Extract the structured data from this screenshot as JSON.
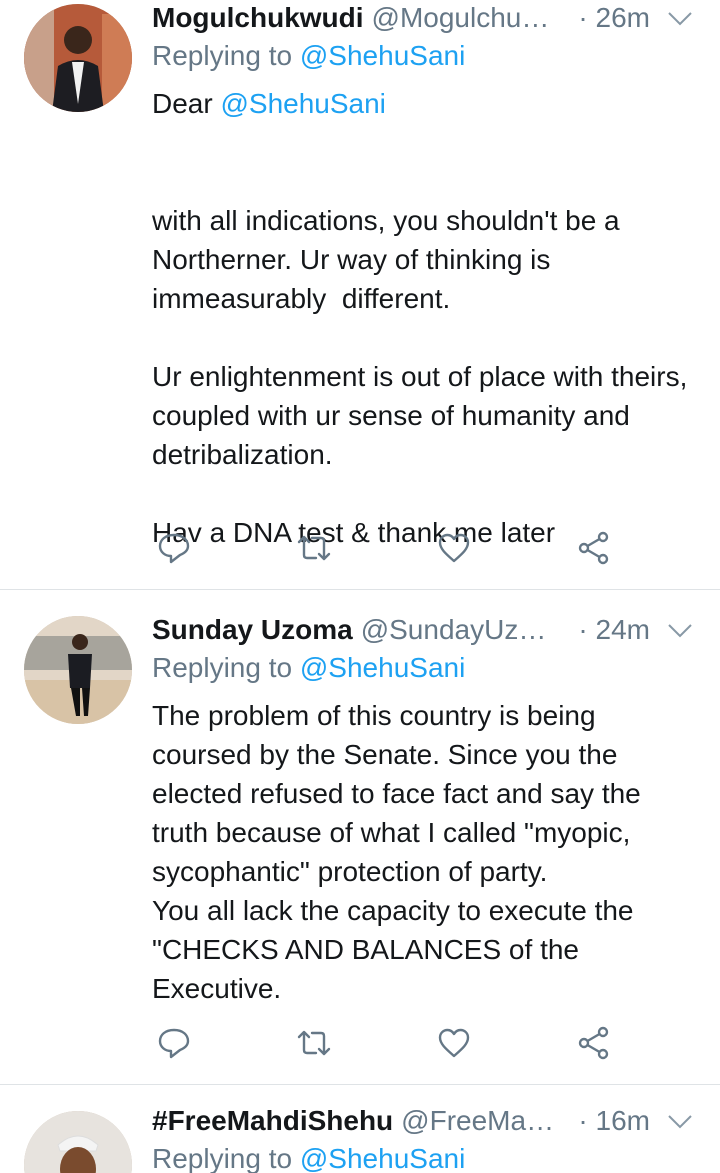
{
  "tweets": [
    {
      "name": "Mogulchukwudi",
      "handle": "@Mogulchu…",
      "time": "· 26m",
      "replying_prefix": "Replying to",
      "replying_to": "@ShehuSani",
      "body_prefix": "Dear ",
      "body_mention": "@ShehuSani",
      "body": "\nwith all indications, you shouldn't be a Northerner. Ur way of thinking is immeasurably  different.\n\nUr enlightenment is out of place with theirs, coupled with ur sense of humanity and detribalization.\n\nHav a DNA test & thank me later"
    },
    {
      "name": "Sunday Uzoma",
      "handle": "@SundayUzo…",
      "time": "· 24m",
      "replying_prefix": "Replying to",
      "replying_to": "@ShehuSani",
      "body": "The problem of this country is being coursed by the Senate. Since you the elected refused to face fact and say the truth because of what I called \"myopic, sycophantic\" protection of party.\nYou all lack the capacity to execute the \"CHECKS AND BALANCES of the Executive."
    },
    {
      "name": "#FreeMahdiShehu",
      "handle": "@FreeMa…",
      "time": "· 16m",
      "replying_prefix": "Replying to",
      "replying_to": "@ShehuSani"
    }
  ],
  "icons": {
    "reply": "reply-icon",
    "retweet": "retweet-icon",
    "like": "heart-icon",
    "share": "share-icon",
    "caret": "chevron-down-icon"
  },
  "colors": {
    "accent": "#1da1f2",
    "muted": "#657786",
    "text": "#14171a"
  }
}
